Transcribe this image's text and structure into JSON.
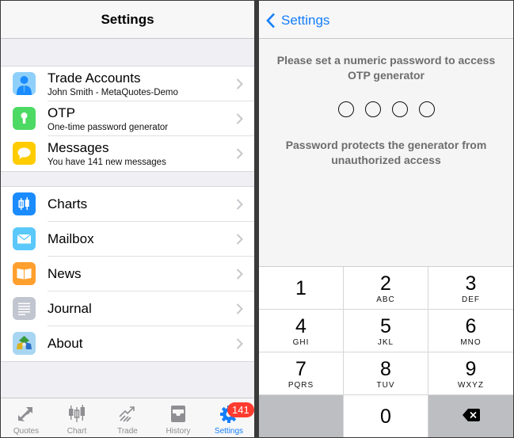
{
  "left_panel": {
    "title": "Settings",
    "groups": [
      {
        "items": [
          {
            "title": "Trade Accounts",
            "subtitle": "John  Smith - MetaQuotes-Demo",
            "icon": "person-icon",
            "color": "#8fd0fb"
          },
          {
            "title": "OTP",
            "subtitle": "One-time password generator",
            "icon": "keyhole-icon",
            "color": "#4cd964"
          },
          {
            "title": "Messages",
            "subtitle": "You have 141 new messages",
            "icon": "speech-bubble-icon",
            "color": "#ffcc00"
          }
        ]
      },
      {
        "items": [
          {
            "title": "Charts",
            "icon": "candlestick-icon",
            "color": "#1a8cff"
          },
          {
            "title": "Mailbox",
            "icon": "envelope-icon",
            "color": "#5ac8fa"
          },
          {
            "title": "News",
            "icon": "book-icon",
            "color": "#ff9f2e"
          },
          {
            "title": "Journal",
            "icon": "document-icon",
            "color": "#c1c5cf"
          },
          {
            "title": "About",
            "icon": "metatrader-logo-icon",
            "color": "#a8d6f2"
          }
        ]
      }
    ],
    "tabbar": {
      "tabs": [
        {
          "label": "Quotes",
          "icon": "arrows-icon"
        },
        {
          "label": "Chart",
          "icon": "candlestick-icon"
        },
        {
          "label": "Trade",
          "icon": "trend-icon"
        },
        {
          "label": "History",
          "icon": "inbox-icon"
        },
        {
          "label": "Settings",
          "icon": "gear-icon",
          "active": true
        }
      ],
      "badge": "141",
      "active_color": "#147efb"
    }
  },
  "right_panel": {
    "back_label": "Settings",
    "prompt": "Please set a numeric password to access OTP generator",
    "info": "Password protects the generator from unauthorized access",
    "pin_length": 4,
    "pin_entered": 0,
    "keypad": [
      {
        "num": "1",
        "letters": ""
      },
      {
        "num": "2",
        "letters": "ABC"
      },
      {
        "num": "3",
        "letters": "DEF"
      },
      {
        "num": "4",
        "letters": "GHI"
      },
      {
        "num": "5",
        "letters": "JKL"
      },
      {
        "num": "6",
        "letters": "MNO"
      },
      {
        "num": "7",
        "letters": "PQRS"
      },
      {
        "num": "8",
        "letters": "TUV"
      },
      {
        "num": "9",
        "letters": "WXYZ"
      },
      {
        "num": "0",
        "letters": ""
      }
    ]
  }
}
